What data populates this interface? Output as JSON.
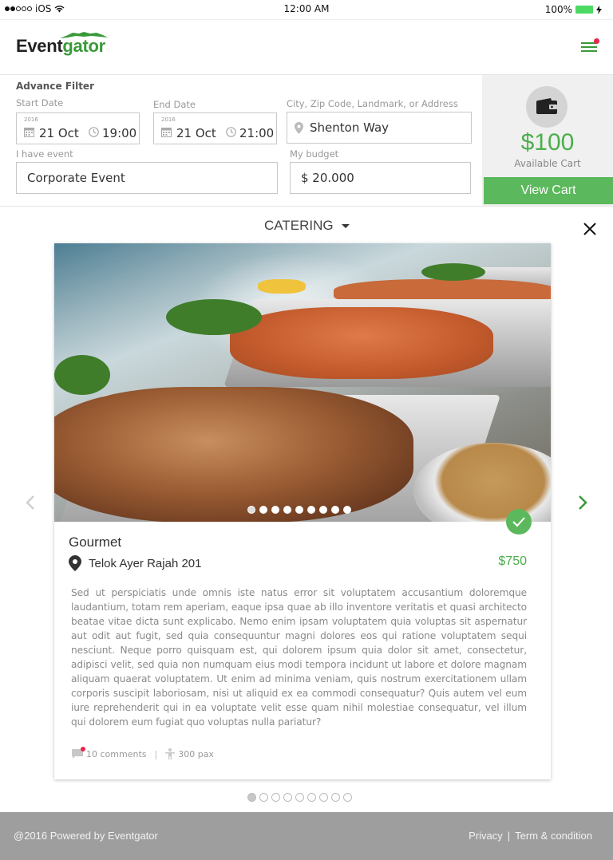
{
  "status": {
    "carrier": "iOS",
    "time": "12:00 AM",
    "battery": "100%"
  },
  "brand": {
    "name_part1": "Event",
    "name_part2": "gator"
  },
  "filter": {
    "title": "Advance Filter",
    "start_label": "Start Date",
    "start_year": "2016",
    "start_date": "21 Oct",
    "start_time": "19:00",
    "end_label": "End Date",
    "end_year": "2016",
    "end_date": "21 Oct",
    "end_time": "21:00",
    "location_label": "City, Zip Code, Landmark, or Address",
    "location_value": "Shenton Way",
    "event_label": "I have event",
    "event_value": "Corporate Event",
    "budget_label": "My budget",
    "budget_value": "$ 20.000"
  },
  "cart": {
    "amount": "$100",
    "label": "Available Cart",
    "button": "View Cart"
  },
  "category": {
    "label": "CATERING"
  },
  "item": {
    "title": "Gourmet",
    "location": "Telok Ayer Rajah 201",
    "price": "$750",
    "description": "Sed ut perspiciatis unde omnis iste natus error sit voluptatem accusantium doloremque laudantium, totam rem aperiam, eaque ipsa quae ab illo inventore veritatis et quasi architecto beatae vitae dicta sunt explicabo. Nemo enim ipsam voluptatem quia voluptas sit aspernatur aut odit aut fugit, sed quia consequuntur magni dolores eos qui ratione voluptatem sequi nesciunt. Neque porro quisquam est, qui dolorem ipsum quia dolor sit amet, consectetur, adipisci velit, sed quia non numquam eius modi tempora incidunt ut labore et dolore magnam aliquam quaerat voluptatem. Ut enim ad minima veniam, quis nostrum exercitationem ullam corporis suscipit laboriosam, nisi ut aliquid ex ea commodi consequatur? Quis autem vel eum iure reprehenderit qui in ea voluptate velit esse quam nihil molestiae consequatur, vel illum qui dolorem eum fugiat quo voluptas nulla pariatur?",
    "comments": "10 comments",
    "capacity": "300 pax",
    "photo_count": 9,
    "photo_active_index": 0
  },
  "pager": {
    "count": 9,
    "active_index": 0
  },
  "footer": {
    "copyright": "@2016 Powered by Eventgator",
    "privacy": "Privacy",
    "separator": "|",
    "terms": "Term & condition"
  },
  "colors": {
    "accent": "#5cb85c",
    "price": "#4cae4c",
    "badge": "#e8264b",
    "footer": "#9e9e9e"
  }
}
